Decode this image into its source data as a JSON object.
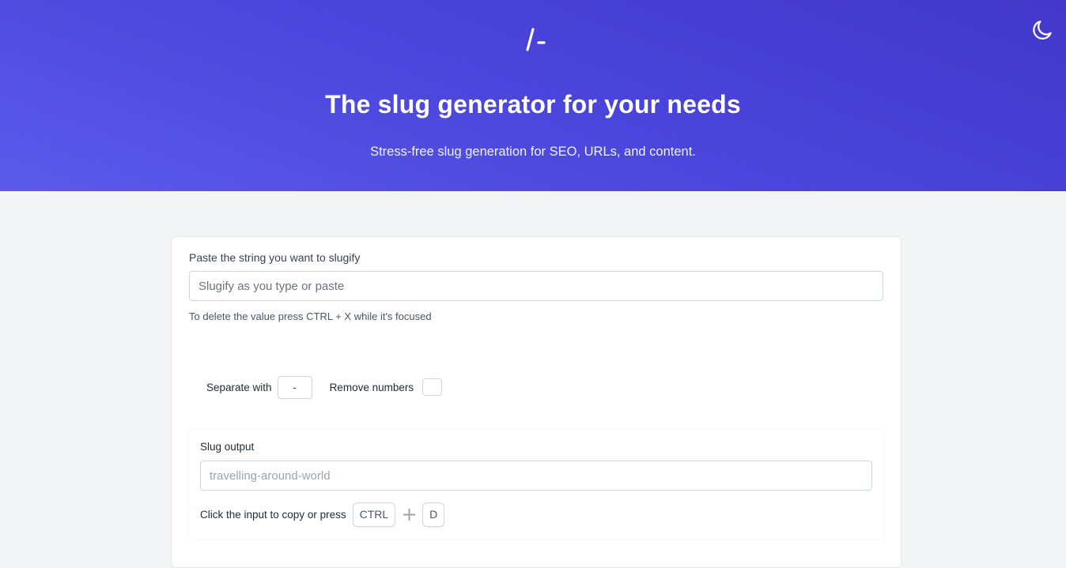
{
  "hero": {
    "logo_text": "/-",
    "title": "The slug generator for your needs",
    "subtitle": "Stress-free slug generation for SEO, URLs, and content.",
    "theme_icon": "moon-icon"
  },
  "form": {
    "input_label": "Paste the string you want to slugify",
    "input_placeholder": "Slugify as you type or paste",
    "input_value": "",
    "help_text": "To delete the value press CTRL + X while it's focused"
  },
  "options": {
    "separator_label": "Separate with",
    "separator_value": "-",
    "remove_numbers_label": "Remove numbers",
    "remove_numbers_checked": false
  },
  "output": {
    "label": "Slug output",
    "value": "travelling-around-world",
    "copy_hint": "Click the input to copy or press",
    "key_ctrl": "CTRL",
    "key_plus_icon": "plus-icon",
    "key_d": "D"
  },
  "colors": {
    "hero_gradient_start": "#4338ca",
    "hero_gradient_end": "#5b5aea",
    "background": "#f3f4f6"
  }
}
